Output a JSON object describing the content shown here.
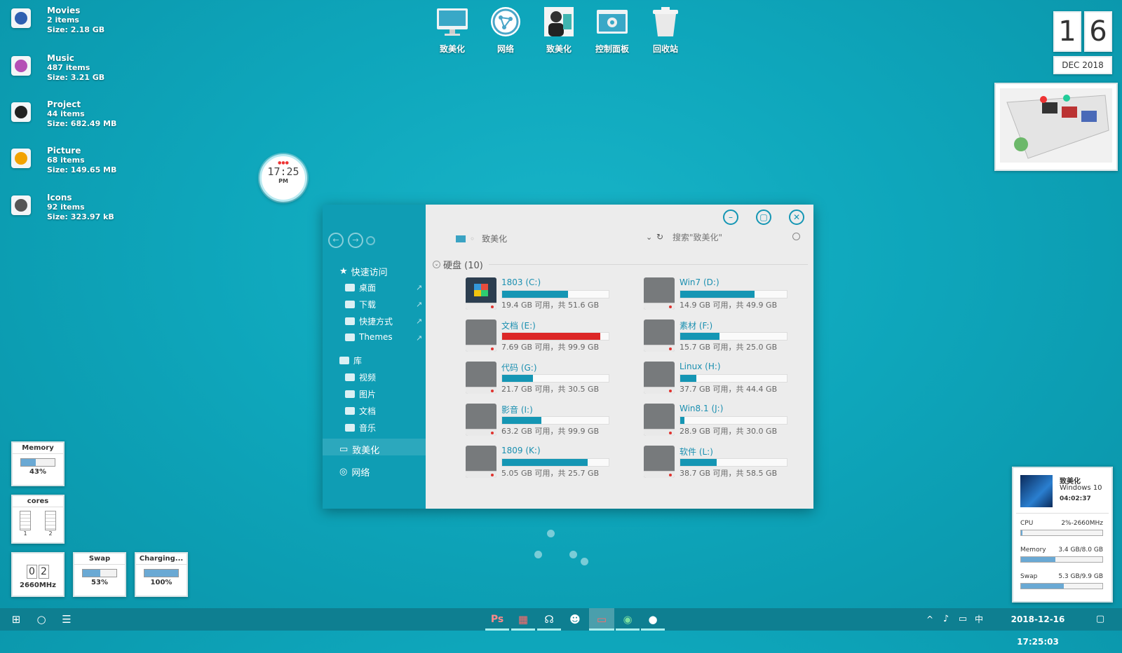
{
  "folders": [
    {
      "name": "Movies",
      "items": "2 items",
      "size": "Size: 2.18 GB",
      "color": "#2f5fb0"
    },
    {
      "name": "Music",
      "items": "487 items",
      "size": "Size: 3.21 GB",
      "color": "#b54fb5"
    },
    {
      "name": "Project",
      "items": "44 items",
      "size": "Size: 682.49 MB",
      "color": "#222"
    },
    {
      "name": "Picture",
      "items": "68 items",
      "size": "Size: 149.65 MB",
      "color": "#f2a200"
    },
    {
      "name": "Icons",
      "items": "92 items",
      "size": "Size: 323.97 kB",
      "color": "#555"
    }
  ],
  "desktop_icons": [
    "致美化",
    "网络",
    "致美化",
    "控制面板",
    "回收站"
  ],
  "clock": {
    "day1": "1",
    "day2": "6",
    "date": "DEC 2018",
    "time": "17:25",
    "ampm": "PM"
  },
  "explorer": {
    "address": "致美化",
    "search_placeholder": "搜索\"致美化\"",
    "section": "硬盘 (10)",
    "nav": {
      "quick_access": "快速访问",
      "desktop": "桌面",
      "downloads": "下载",
      "shortcuts": "快捷方式",
      "themes": "Themes",
      "library": "库",
      "videos": "视频",
      "pictures": "图片",
      "documents": "文档",
      "music": "音乐",
      "computer": "致美化",
      "network": "网络"
    },
    "drives": [
      {
        "name": "1803 (C:)",
        "size": "19.4 GB 可用，共 51.6 GB",
        "used": 0.62,
        "red": false
      },
      {
        "name": "Win7 (D:)",
        "size": "14.9 GB 可用，共 49.9 GB",
        "used": 0.7,
        "red": false
      },
      {
        "name": "文档 (E:)",
        "size": "7.69 GB 可用，共 99.9 GB",
        "used": 0.92,
        "red": true
      },
      {
        "name": "素材 (F:)",
        "size": "15.7 GB 可用，共 25.0 GB",
        "used": 0.37,
        "red": false
      },
      {
        "name": "代码 (G:)",
        "size": "21.7 GB 可用，共 30.5 GB",
        "used": 0.29,
        "red": false
      },
      {
        "name": "Linux (H:)",
        "size": "37.7 GB 可用，共 44.4 GB",
        "used": 0.15,
        "red": false
      },
      {
        "name": "影音 (I:)",
        "size": "63.2 GB 可用，共 99.9 GB",
        "used": 0.37,
        "red": false
      },
      {
        "name": "Win8.1 (J:)",
        "size": "28.9 GB 可用，共 30.0 GB",
        "used": 0.04,
        "red": false
      },
      {
        "name": "1809 (K:)",
        "size": "5.05 GB 可用，共 25.7 GB",
        "used": 0.8,
        "red": false
      },
      {
        "name": "软件 (L:)",
        "size": "38.7 GB 可用，共 58.5 GB",
        "used": 0.34,
        "red": false
      }
    ]
  },
  "gadgets": {
    "memory": {
      "title": "Memory",
      "value": "43%",
      "level": 0.43
    },
    "cores": {
      "title": "cores",
      "c1": "1",
      "c2": "2"
    },
    "cpu": {
      "d1": "0",
      "d2": "2",
      "freq": "2660MHz"
    },
    "swap": {
      "title": "Swap",
      "value": "53%",
      "level": 0.53
    },
    "charging": {
      "title": "Charging...",
      "value": "100%",
      "level": 1.0
    }
  },
  "sysinfo": {
    "name": "致美化",
    "os": "Windows 10",
    "uptime": "04:02:37",
    "cpu_label": "CPU",
    "cpu_val": "2%-2660MHz",
    "cpu_level": 0.02,
    "mem_label": "Memory",
    "mem_val": "3.4 GB/8.0 GB",
    "mem_level": 0.42,
    "swap_label": "Swap",
    "swap_val": "5.3 GB/9.9 GB",
    "swap_level": 0.53
  },
  "taskbar": {
    "datetime": "2018-12-16  17:25:03",
    "ime": "中",
    "ps": "Ps"
  }
}
